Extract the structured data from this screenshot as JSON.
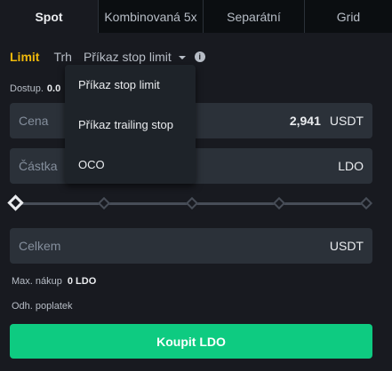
{
  "tabs": [
    {
      "label": "Spot",
      "active": true
    },
    {
      "label": "Kombinovaná 5x",
      "active": false
    },
    {
      "label": "Separátní",
      "active": false
    },
    {
      "label": "Grid",
      "active": false
    }
  ],
  "order_types": {
    "limit": "Limit",
    "market": "Trh",
    "stop": "Příkaz stop limit"
  },
  "available": {
    "label": "Dostup.",
    "value": "0.0"
  },
  "price": {
    "label": "Cena",
    "value": "2,941",
    "unit": "USDT"
  },
  "amount": {
    "label": "Částka",
    "unit": "LDO"
  },
  "total": {
    "label": "Celkem",
    "unit": "USDT"
  },
  "slider": {
    "value_percent": 0,
    "marks_percent": [
      0,
      25,
      50,
      75,
      100
    ]
  },
  "max_buy": {
    "label": "Max. nákup",
    "value": "0 LDO"
  },
  "est_fee": {
    "label": "Odh. poplatek"
  },
  "buy_button": "Koupit LDO",
  "dropdown": {
    "items": [
      "Příkaz stop limit",
      "Příkaz trailing stop",
      "OCO"
    ]
  },
  "colors": {
    "accent": "#f0b90b",
    "buy": "#0ecb81",
    "background": "#181a20",
    "input_bg": "#2b3139"
  }
}
